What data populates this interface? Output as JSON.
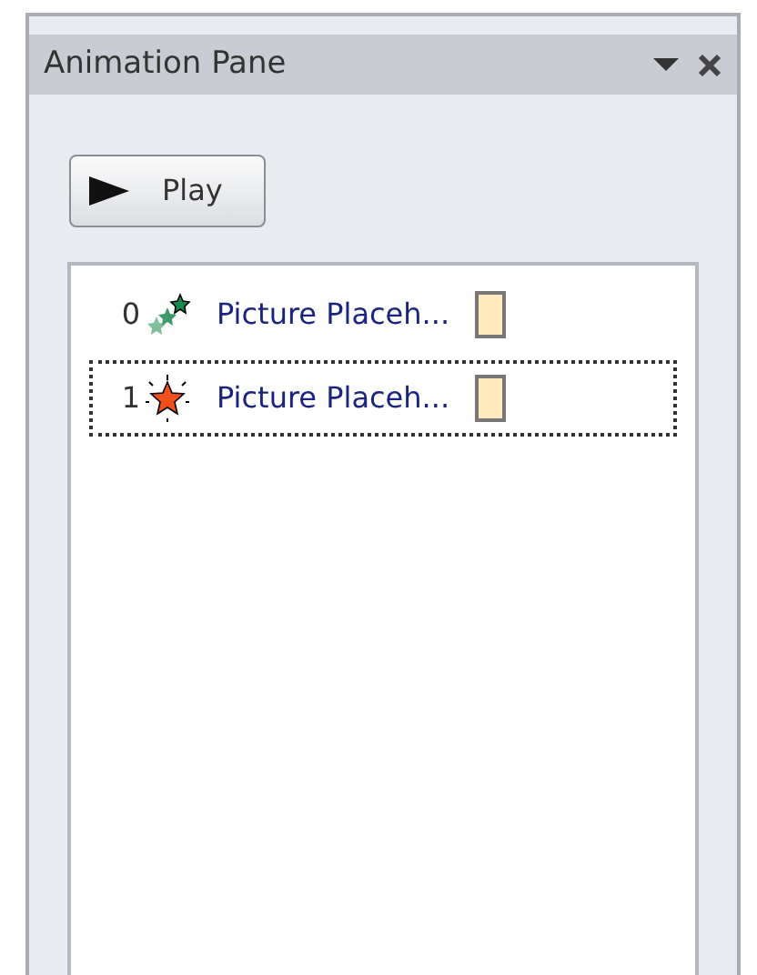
{
  "pane": {
    "title": "Animation Pane"
  },
  "play_button": {
    "label": "Play"
  },
  "animations": [
    {
      "number": "0",
      "kind": "entrance",
      "label": "Picture Placeh...",
      "selected": false
    },
    {
      "number": "1",
      "kind": "emphasis",
      "label": "Picture Placeh...",
      "selected": true
    }
  ]
}
